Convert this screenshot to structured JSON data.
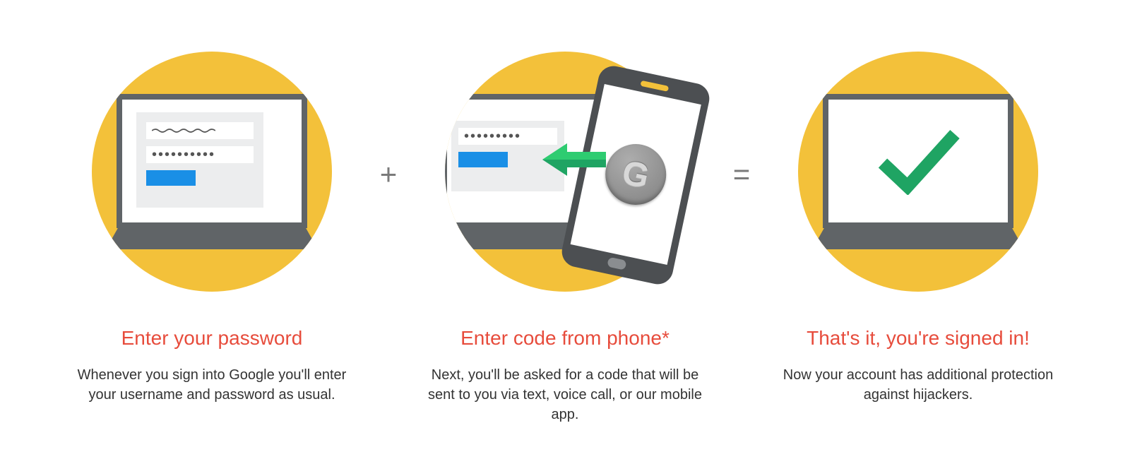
{
  "steps": [
    {
      "title": "Enter your password",
      "description": "Whenever you sign into Google you'll enter your username and password as usual."
    },
    {
      "title": "Enter code from phone*",
      "description": "Next, you'll be asked for a code that will be sent to you via text, voice call, or our mobile app."
    },
    {
      "title": "That's it, you're signed in!",
      "description": "Now your account has additional protection against hijackers."
    }
  ],
  "operators": {
    "plus": "+",
    "equals": "="
  },
  "icons": {
    "authenticator_letter": "G"
  }
}
